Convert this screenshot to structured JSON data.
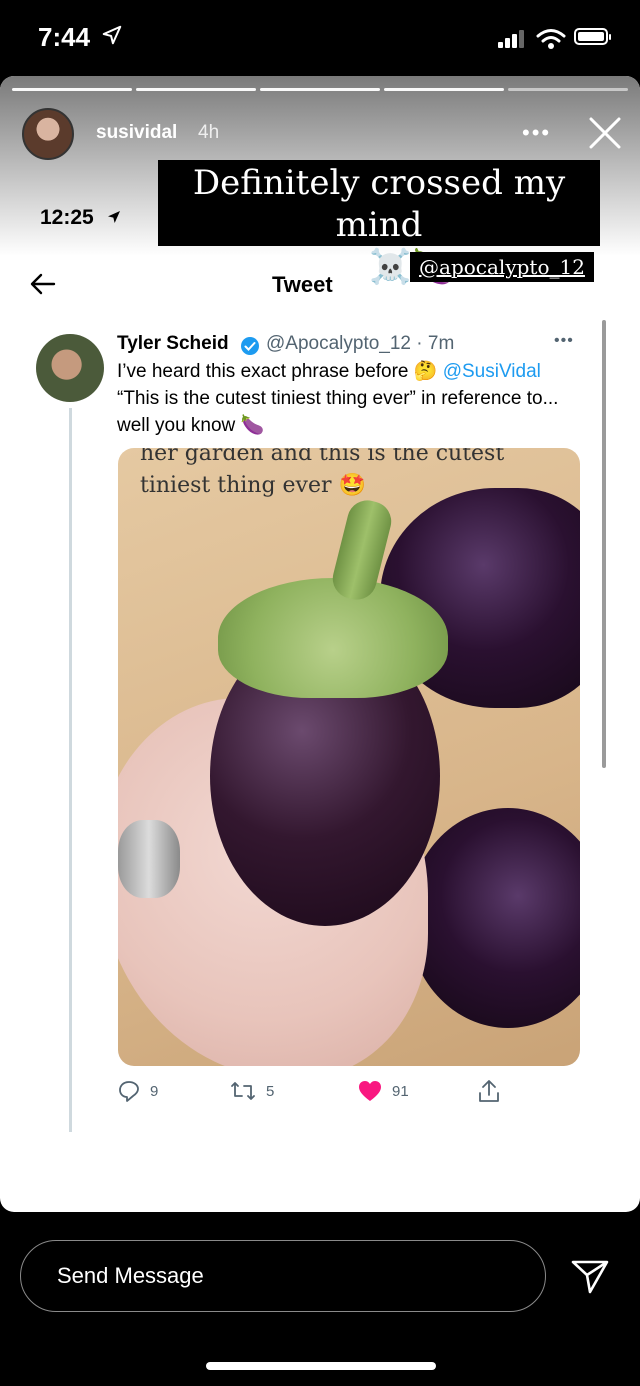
{
  "status_bar": {
    "time": "7:44"
  },
  "story": {
    "username": "susividal",
    "posted_ago": "4h",
    "progress_segments_done": 4,
    "progress_segments_total": 5,
    "caption_line1": "Definitely crossed my mind",
    "caption_line2": "too ☠️🍆",
    "mention_sticker": "@apocalypto_12"
  },
  "screenshot": {
    "status_time": "12:25",
    "header_title": "Tweet",
    "tweet": {
      "author_name": "Tyler Scheid",
      "author_handle_time": "@Apocalypto_12 · 7m",
      "text_part1": "I’ve heard this exact phrase before 🤔 ",
      "text_mention": "@SusiVidal",
      "text_part2": "“This is the cutest tiniest thing ever” in reference to... well you know 🍆",
      "photo_caption_line1": "her garden and this is the cutest",
      "photo_caption_line2": "tiniest thing ever 🤩",
      "replies": "9",
      "retweets": "5",
      "likes": "91",
      "like_color": "#f91880"
    }
  },
  "message_bar": {
    "placeholder": "Send Message"
  }
}
